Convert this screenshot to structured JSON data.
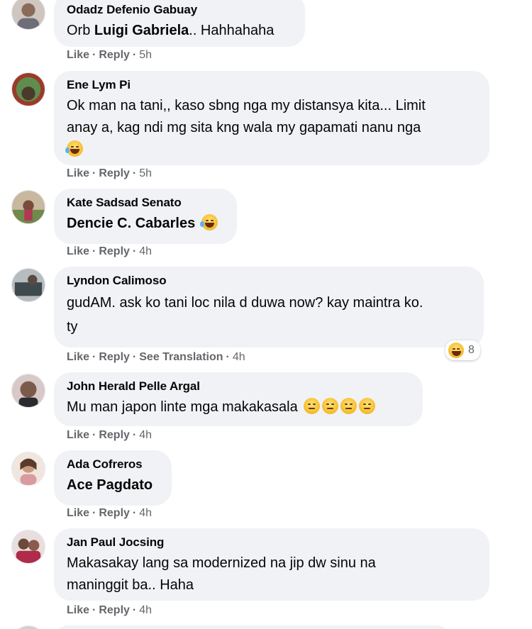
{
  "comments": [
    {
      "author": "Odadz Defenio Gabuay",
      "prefix": "Orb ",
      "mention": "Luigi Gabriela",
      "suffix": ".. Hahhahaha",
      "like": "Like",
      "reply": "Reply",
      "time": "5h"
    },
    {
      "author": "Ene Lym Pi",
      "line1": "Ok man na tani,, kaso sbng nga my distansya kita... Limit",
      "line2": "anay a, kag ndi mg sita kng wala my gapamati nanu nga",
      "emoji": "rolling-laughing-icon",
      "like": "Like",
      "reply": "Reply",
      "time": "5h"
    },
    {
      "author": "Kate Sadsad Senato",
      "mention": "Dencie C. Cabarles",
      "emoji": "joy-icon",
      "like": "Like",
      "reply": "Reply",
      "time": "4h"
    },
    {
      "author": "Lyndon Calimoso",
      "line1": "gudAM. ask ko tani loc nila d duwa now? kay maintra ko.",
      "line2": "ty",
      "like": "Like",
      "reply": "Reply",
      "translate": "See Translation",
      "time": "4h",
      "reaction_count": "8",
      "reaction_icon": "haha-reaction-icon"
    },
    {
      "author": "John Herald Pelle Argal",
      "text": "Mu man japon linte mga makakasala",
      "emojis": [
        "expressionless-icon",
        "expressionless-icon",
        "expressionless-icon",
        "expressionless-icon"
      ],
      "like": "Like",
      "reply": "Reply",
      "time": "4h"
    },
    {
      "author": "Ada Cofreros",
      "mention": "Ace Pagdato",
      "like": "Like",
      "reply": "Reply",
      "time": "4h"
    },
    {
      "author": "Jan Paul Jocsing",
      "line1": "Makasakay lang sa modernized na jip dw sinu na",
      "line2": "maninggit ba.. Haha",
      "like": "Like",
      "reply": "Reply",
      "time": "4h"
    }
  ],
  "separator": "·",
  "colors": {
    "bubble": "#f0f2f5",
    "meta": "#65676b",
    "text": "#050505"
  }
}
